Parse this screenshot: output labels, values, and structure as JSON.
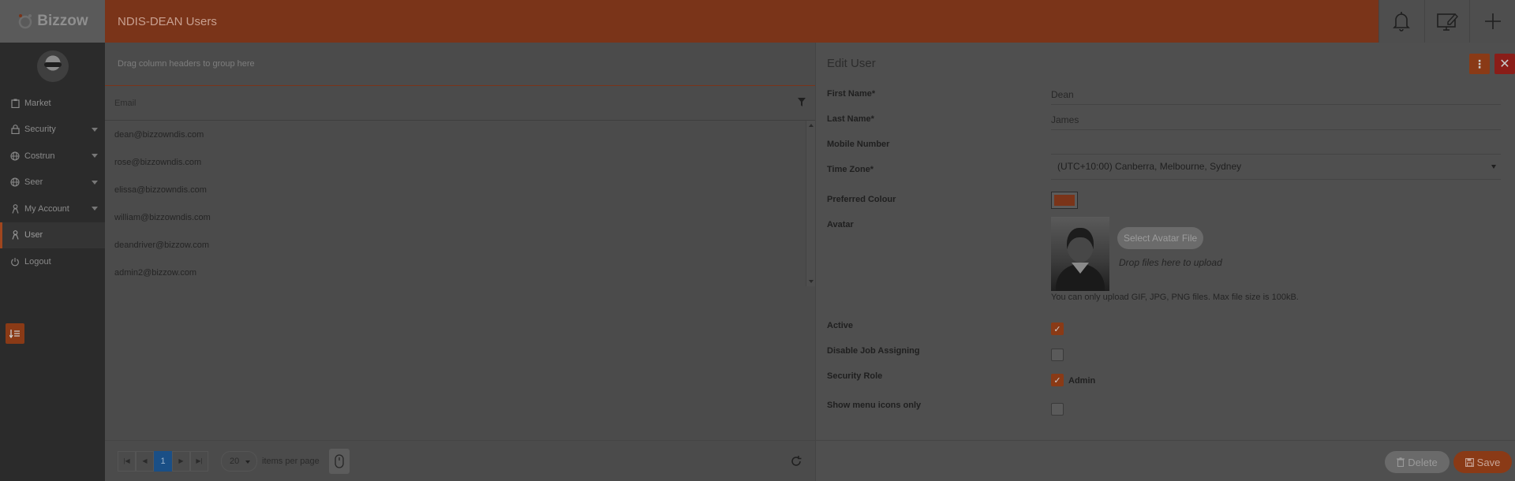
{
  "brand": {
    "name": "Bizzow"
  },
  "header": {
    "title": "NDIS-DEAN Users"
  },
  "sidebar": {
    "items": [
      {
        "label": "Market",
        "icon": "clipboard-icon",
        "caret": false,
        "active": false
      },
      {
        "label": "Security",
        "icon": "lock-icon",
        "caret": true,
        "active": false
      },
      {
        "label": "Costrun",
        "icon": "globe-icon",
        "caret": true,
        "active": false
      },
      {
        "label": "Seer",
        "icon": "globe-icon",
        "caret": true,
        "active": false
      },
      {
        "label": "My Account",
        "icon": "person-icon",
        "caret": true,
        "active": false
      },
      {
        "label": "User",
        "icon": "person-icon",
        "caret": false,
        "active": true
      },
      {
        "label": "Logout",
        "icon": "power-icon",
        "caret": false,
        "active": false
      }
    ]
  },
  "grid": {
    "group_hint": "Drag column headers to group here",
    "column": "Email",
    "rows": [
      "dean@bizzowndis.com",
      "rose@bizzowndis.com",
      "elissa@bizzowndis.com",
      "william@bizzowndis.com",
      "deandriver@bizzow.com",
      "admin2@bizzow.com"
    ],
    "pager": {
      "current_page": "1",
      "page_size": "20",
      "per_page_label": "items per page"
    }
  },
  "edit": {
    "title": "Edit User",
    "fields": {
      "first_name_label": "First Name*",
      "first_name": "Dean",
      "last_name_label": "Last Name*",
      "last_name": "James",
      "mobile_label": "Mobile Number",
      "mobile": "",
      "timezone_label": "Time Zone*",
      "timezone": "(UTC+10:00) Canberra, Melbourne, Sydney",
      "colour_label": "Preferred Colour",
      "colour_value": "#c9501f",
      "avatar_label": "Avatar",
      "select_file": "Select Avatar File",
      "drop_hint": "Drop files here to upload",
      "upload_hint": "You can only upload GIF, JPG, PNG files. Max file size is 100kB.",
      "active_label": "Active",
      "active": true,
      "disable_job_label": "Disable Job Assigning",
      "disable_job": false,
      "role_label": "Security Role",
      "role_value": "Admin",
      "role_checked": true,
      "menu_icons_label": "Show menu icons only",
      "menu_icons": false
    },
    "buttons": {
      "delete": "Delete",
      "save": "Save"
    }
  }
}
